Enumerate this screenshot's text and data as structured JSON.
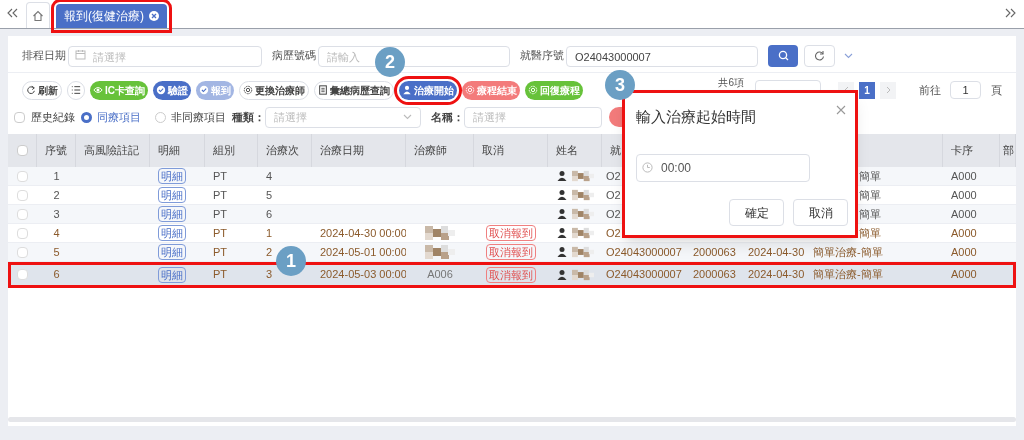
{
  "tabs": [
    {
      "kind": "home",
      "selected": false
    },
    {
      "kind": "page",
      "label": "報到(復健治療)",
      "selected": true
    }
  ],
  "search": [
    {
      "label": "排程日期",
      "placeholder": "請選擇",
      "kind": "date"
    },
    {
      "label": "病歷號碼",
      "placeholder": "請輸入",
      "kind": "text"
    },
    {
      "label": "就醫序號",
      "value": "O24043000007",
      "kind": "text"
    }
  ],
  "toolbar": [
    {
      "label": "刷新",
      "kind": "default"
    },
    {
      "kind": "default"
    },
    {
      "label": "IC卡查詢",
      "kind": "green"
    },
    {
      "label": "驗證",
      "kind": "blue"
    },
    {
      "label": "報到",
      "kind": "light"
    },
    {
      "label": "更換治療師",
      "kind": "default"
    },
    {
      "label": "彙總病歷查詢",
      "kind": "default"
    },
    {
      "label": "治療開始",
      "kind": "blue"
    },
    {
      "label": "療程結束",
      "kind": "red"
    },
    {
      "label": "回復療程",
      "kind": "green"
    }
  ],
  "pagination": {
    "total": "共6項",
    "pages": [
      {
        "label": "1",
        "selected": true
      }
    ],
    "goto_label": "前往",
    "goto_value": "1",
    "goto_suffix": "頁"
  },
  "filters": {
    "history": {
      "label": "歷史紀錄",
      "checked": false
    },
    "radios": [
      {
        "label": "同療項目",
        "selected": true
      },
      {
        "label": "非同療項目",
        "selected": false
      }
    ],
    "type": {
      "label": "種類：",
      "placeholder": "請選擇"
    },
    "name": {
      "label": "名稱：",
      "placeholder": "請選擇"
    }
  },
  "table": {
    "header_checked": false,
    "columns": [
      {
        "label": "序號"
      },
      {
        "label": "高風險註記"
      },
      {
        "label": "明細"
      },
      {
        "label": "組別"
      },
      {
        "label": "治療次"
      },
      {
        "label": "治療日期"
      },
      {
        "label": "治療師"
      },
      {
        "label": "取消"
      },
      {
        "label": "姓名"
      },
      {
        "label": "就"
      },
      {},
      {},
      {},
      {
        "label": "卡序"
      },
      {
        "label": "部"
      }
    ],
    "rows": [
      {
        "no": "1",
        "detail": "明細",
        "group": "PT",
        "session": "4",
        "visit_no": "O2",
        "treatment": "簡單",
        "treatment_partial": true,
        "card": "A000",
        "reported": false,
        "selected": false,
        "checked": false
      },
      {
        "no": "2",
        "detail": "明細",
        "group": "PT",
        "session": "5",
        "visit_no": "O2",
        "treatment": "簡單",
        "treatment_partial": true,
        "card": "A000",
        "reported": false,
        "selected": false,
        "checked": false
      },
      {
        "no": "3",
        "detail": "明細",
        "group": "PT",
        "session": "6",
        "visit_no": "O2",
        "treatment": "簡單",
        "treatment_partial": true,
        "card": "A000",
        "reported": false,
        "selected": false,
        "checked": false
      },
      {
        "no": "4",
        "detail": "明細",
        "group": "PT",
        "session": "1",
        "date": "2024-04-30 00:00",
        "therapist_redacted": true,
        "cancel": "取消報到",
        "visit_no": "O2",
        "treatment": "簡單",
        "treatment_partial": true,
        "card": "A000",
        "reported": true,
        "selected": false,
        "checked": false
      },
      {
        "no": "5",
        "detail": "明細",
        "group": "PT",
        "session": "2",
        "date": "2024-05-01 00:00",
        "therapist_redacted": true,
        "cancel": "取消報到",
        "visit_no": "O24043000007",
        "column_12": "2000063",
        "column_13": "2024-04-30",
        "treatment": "簡單治療-簡單",
        "card": "A000",
        "reported": true,
        "selected": false,
        "checked": false
      },
      {
        "no": "6",
        "detail": "明細",
        "group": "PT",
        "session": "3",
        "date": "2024-05-03 00:00",
        "therapist": "A006",
        "cancel": "取消報到",
        "visit_no": "O24043000007",
        "column_12": "2000063",
        "column_13": "2024-04-30",
        "treatment": "簡單治療-簡單",
        "card": "A000",
        "reported": true,
        "selected": true,
        "checked": false
      }
    ]
  },
  "dialog": {
    "title": "輸入治療起始時間",
    "time_value": "00:00",
    "buttons": [
      {
        "label": "確定"
      },
      {
        "label": "取消"
      }
    ]
  },
  "annotations": [
    {
      "label": "1"
    },
    {
      "label": "2"
    },
    {
      "label": "3"
    }
  ]
}
